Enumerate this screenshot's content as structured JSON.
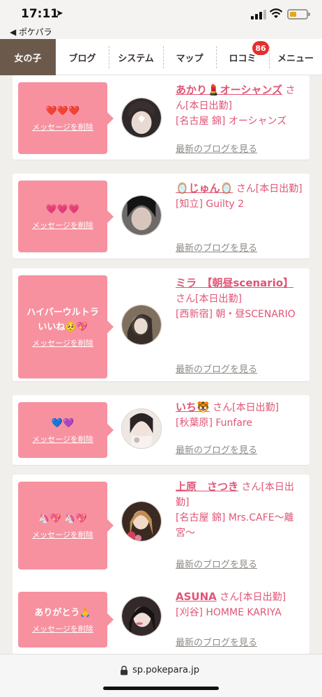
{
  "status_bar": {
    "time": "17:11",
    "back_app": "◀ ポケパラ"
  },
  "nav": {
    "tabs": [
      {
        "label": "女の子",
        "active": true
      },
      {
        "label": "ブログ"
      },
      {
        "label": "システム"
      },
      {
        "label": "マップ"
      },
      {
        "label": "ロコミ"
      },
      {
        "label": "メニュー"
      }
    ],
    "badge": "86"
  },
  "delete_label": "メッセージを削除",
  "blog_label": "最新のブログを見る",
  "cards": [
    {
      "message": "❤️❤️❤️",
      "name": "あかり💄オーシャンズ",
      "suffix": "さん[本日出勤]",
      "shop": "[名古屋 錦] オーシャンズ"
    },
    {
      "message": "💗💗💗",
      "name": "🪞じゅん🪞",
      "suffix": "さん[本日出勤]",
      "shop": "[知立] Guilty 2"
    },
    {
      "message": "ハイパーウルトラいいね🥺💖",
      "name": "ミラ　【朝昼scenario】",
      "suffix": "さん[本日出勤]",
      "shop": "[西新宿] 朝・昼SCENARIO"
    },
    {
      "message": "💙💜",
      "name": "いち🐯",
      "suffix": "さん[本日出勤]",
      "shop": "[秋葉原] Funfare"
    },
    {
      "message": "🦄💖 🦄💖",
      "name": "上原　さつき",
      "suffix": "さん[本日出勤]",
      "shop": "[名古屋 錦] Mrs.CAFE〜離宮〜"
    },
    {
      "message": "ありがとう🙏",
      "name": "ASUNA",
      "suffix": "さん[本日出勤]",
      "shop": "[刈谷] HOMME KARIYA"
    }
  ],
  "url_bar": {
    "url": "sp.pokepara.jp"
  },
  "colors": {
    "nav_active": "#6b5a4b",
    "message_bg": "#f7919f",
    "name_color": "#e05576",
    "badge": "#e62e2e"
  }
}
